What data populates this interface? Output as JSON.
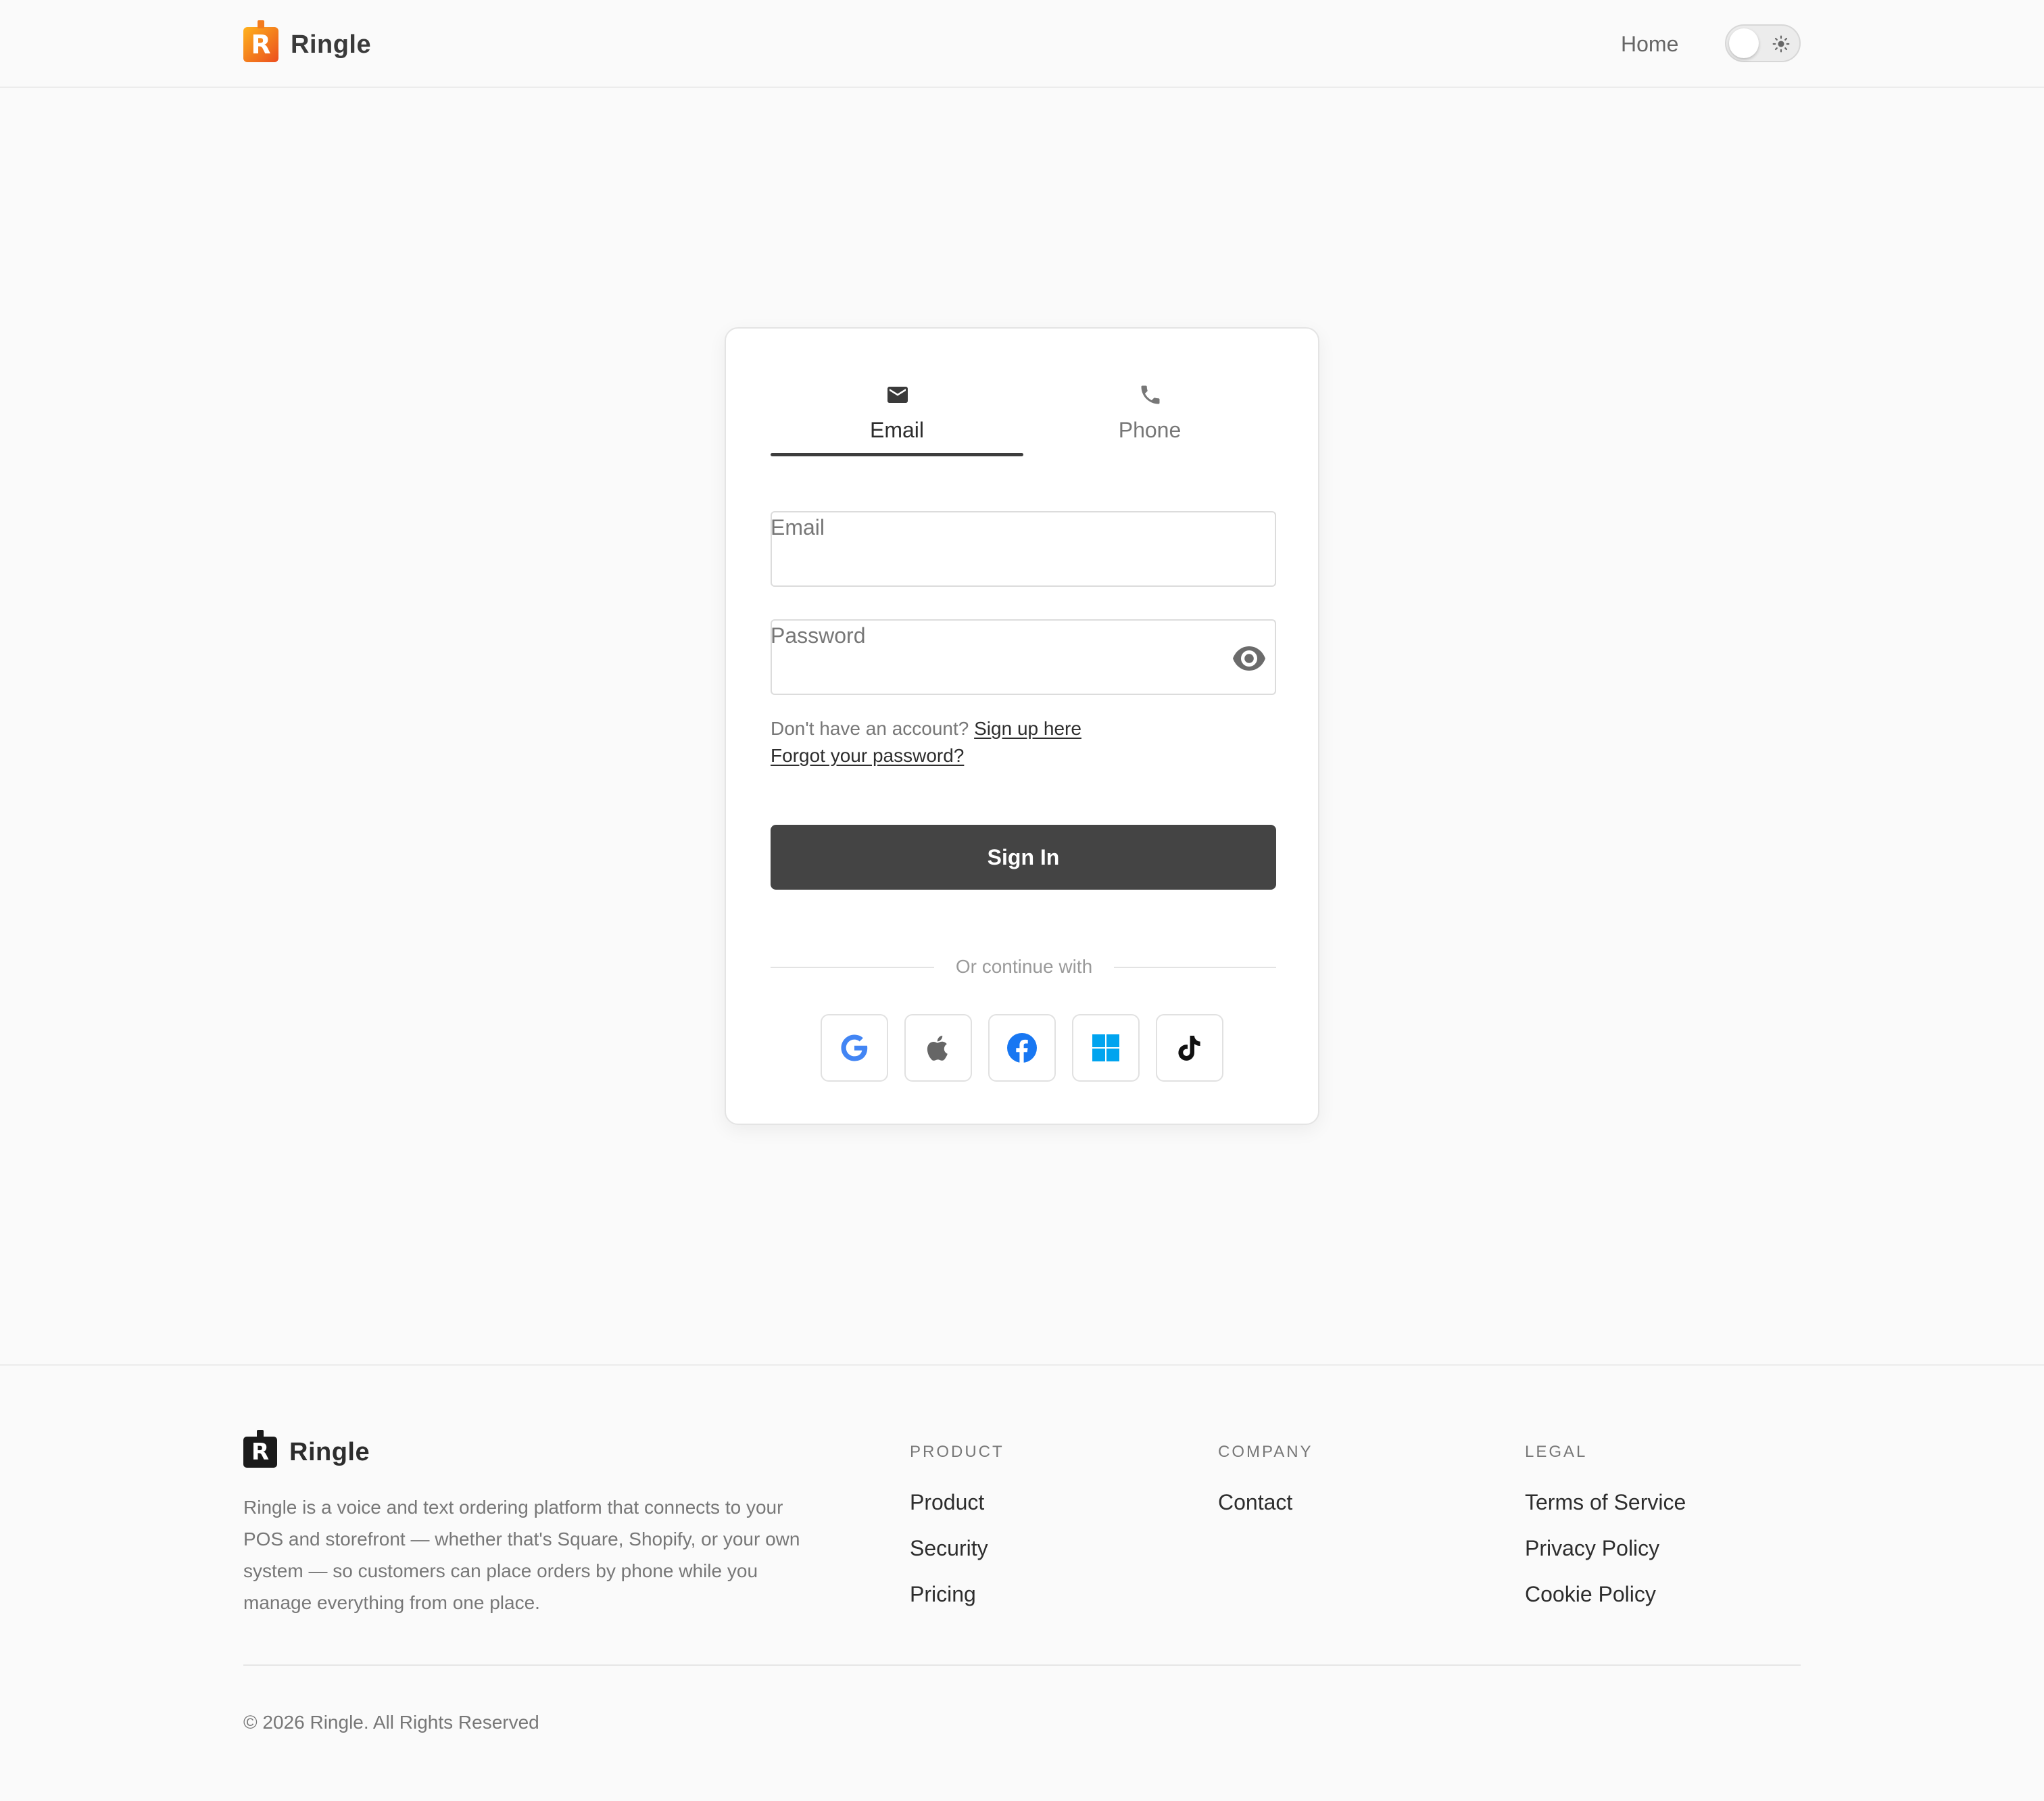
{
  "header": {
    "brand": {
      "logo_letter": "R",
      "name": "Ringle"
    },
    "nav": {
      "home": "Home"
    },
    "theme_toggle": {
      "icon": "sun-icon"
    }
  },
  "login": {
    "tabs": [
      {
        "label": "Email",
        "icon": "mail-icon",
        "active": true
      },
      {
        "label": "Phone",
        "icon": "phone-icon",
        "active": false
      }
    ],
    "fields": {
      "email": {
        "label": "Email",
        "value": "",
        "placeholder": ""
      },
      "password": {
        "label": "Password",
        "value": "",
        "placeholder": "",
        "toggle_icon": "eye-icon"
      }
    },
    "signup_prompt": "Don't have an account?",
    "signup_link": "Sign up here",
    "forgot_link": "Forgot your password?",
    "submit_label": "Sign In",
    "divider_text": "Or continue with",
    "social": [
      {
        "name": "Google",
        "icon": "google-icon",
        "color": "#4285F4"
      },
      {
        "name": "Apple",
        "icon": "apple-icon",
        "color": "#666666"
      },
      {
        "name": "Facebook",
        "icon": "facebook-icon",
        "color": "#1877F2"
      },
      {
        "name": "Microsoft",
        "icon": "windows-icon",
        "color": "#00A4EF"
      },
      {
        "name": "TikTok",
        "icon": "tiktok-icon",
        "color": "#111111"
      }
    ]
  },
  "footer": {
    "brand": {
      "logo_letter": "R",
      "name": "Ringle"
    },
    "description": "Ringle is a voice and text ordering platform that connects to your POS and storefront — whether that's Square, Shopify, or your own system — so customers can place orders by phone while you manage everything from one place.",
    "columns": [
      {
        "heading": "PRODUCT",
        "links": [
          "Product",
          "Security",
          "Pricing"
        ]
      },
      {
        "heading": "COMPANY",
        "links": [
          "Contact"
        ]
      },
      {
        "heading": "LEGAL",
        "links": [
          "Terms of Service",
          "Privacy Policy",
          "Cookie Policy"
        ]
      }
    ],
    "copyright": "© 2026 Ringle. All Rights Reserved"
  },
  "colors": {
    "background": "#fafafa",
    "primary_button": "#444444",
    "text": "#2d2d2d",
    "muted_text": "#777777",
    "brand_gradient_start": "#ffb21d",
    "brand_gradient_end": "#ec4d1f"
  }
}
